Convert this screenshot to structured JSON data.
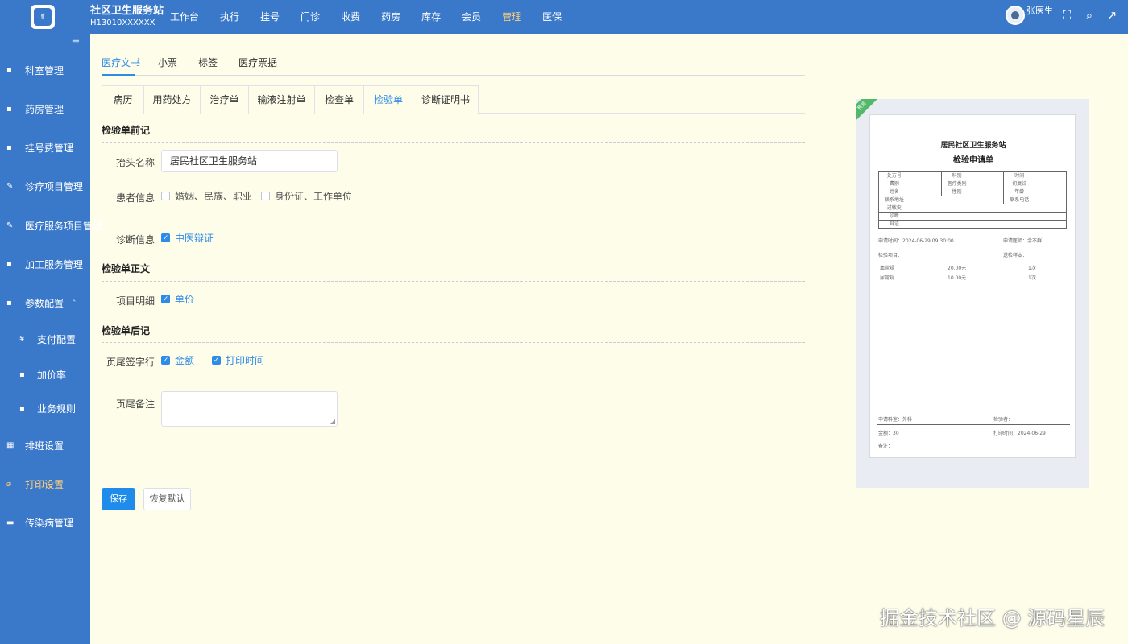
{
  "header": {
    "logo_glyph": "☤",
    "brand_name": "社区卫生服务站",
    "brand_code": "H13010XXXXXX",
    "nav": [
      "工作台",
      "执行",
      "挂号",
      "门诊",
      "收费",
      "药房",
      "库存",
      "会员",
      "管理",
      "医保"
    ],
    "active_nav": "管理",
    "user_name": "张医生",
    "icons": [
      "fullscreen-icon",
      "search-icon",
      "external-link-icon"
    ]
  },
  "sidebar": {
    "items": [
      {
        "label": "科室管理",
        "icon": "file-icon"
      },
      {
        "label": "药房管理",
        "icon": "pill-box-icon"
      },
      {
        "label": "挂号费管理",
        "icon": "bag-icon"
      },
      {
        "label": "诊疗项目管理",
        "icon": "wrench-icon"
      },
      {
        "label": "医疗服务项目管理",
        "icon": "wrench-icon"
      },
      {
        "label": "加工服务管理",
        "icon": "thumb-icon"
      },
      {
        "label": "参数配置",
        "icon": "edit-doc-icon"
      },
      {
        "label": "支付配置",
        "icon": "yen-icon"
      },
      {
        "label": "加价率",
        "icon": "square-icon"
      },
      {
        "label": "业务规则",
        "icon": "doc-icon"
      },
      {
        "label": "排班设置",
        "icon": "grid-icon"
      },
      {
        "label": "打印设置",
        "icon": "paperclip-icon"
      },
      {
        "label": "传染病管理",
        "icon": "bed-icon"
      }
    ]
  },
  "doc_tabs": [
    "医疗文书",
    "小票",
    "标签",
    "医疗票据"
  ],
  "form_tabs": [
    "病历",
    "用药处方",
    "治疗单",
    "输液注射单",
    "检查单",
    "检验单",
    "诊断证明书"
  ],
  "form": {
    "section_header": "检验单前记",
    "header_name_label": "抬头名称",
    "header_name_value": "居民社区卫生服务站",
    "patient_info_label": "患者信息",
    "patient_opt1": "婚姻、民族、职业",
    "patient_opt2": "身份证、工作单位",
    "diag_label": "诊断信息",
    "diag_opt": "中医辩证",
    "section_body": "检验单正文",
    "item_detail_label": "项目明细",
    "item_detail_opt": "单价",
    "section_footer": "检验单后记",
    "sign_label": "页尾签字行",
    "sign_opt1": "金额",
    "sign_opt2": "打印时间",
    "note_label": "页尾备注",
    "save": "保存",
    "reset": "恢复默认"
  },
  "preview": {
    "badge": "预览",
    "org": "居民社区卫生服务站",
    "title": "检验申请单",
    "rows": [
      [
        "处方号",
        "",
        "科别",
        "",
        "时间",
        ""
      ],
      [
        "费别",
        "",
        "医疗类别",
        "",
        "初复诊",
        ""
      ],
      [
        "姓名",
        "",
        "性别",
        "",
        "年龄",
        ""
      ]
    ],
    "row_contact": [
      "联系地址",
      "",
      "联系电话",
      ""
    ],
    "row_labels": [
      "过敏史",
      "诊断",
      "辩证"
    ],
    "apply_time": "申请时间：2024-06-29 09:30:00",
    "apply_doctor": "申请医师：余不群",
    "test_item": "检验项目：",
    "specimen": "送检样本：",
    "items": [
      {
        "name": "血常规",
        "price": "20.00元",
        "qty": "1次"
      },
      {
        "name": "尿常规",
        "price": "10.00元",
        "qty": "1次"
      }
    ],
    "dept": "申请科室：外科",
    "tester": "检验者：",
    "amount": "金额：30",
    "print_time": "打印时间：2024-06-29",
    "remark": "备注："
  },
  "watermark": "掘金技术社区 @ 源码星辰"
}
